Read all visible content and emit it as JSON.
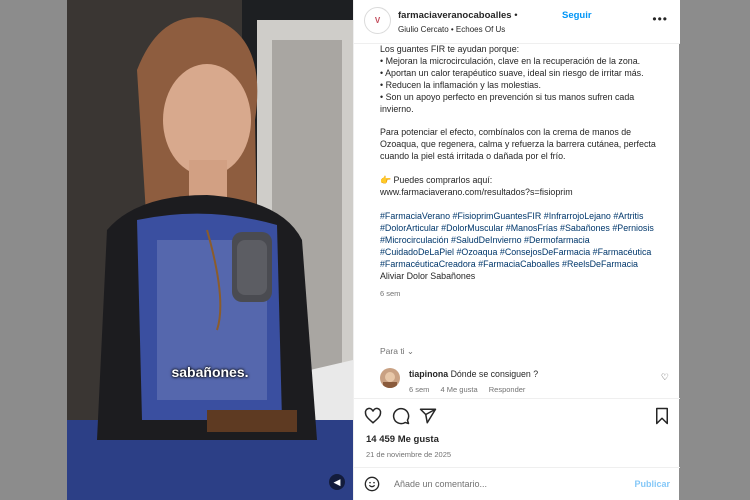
{
  "media": {
    "overlay_text": "sabañones."
  },
  "header": {
    "avatar_text": "V",
    "username": "farmaciaveranocaboalles",
    "separator": "•",
    "follow": "Seguir",
    "audio": "Giulio Cercato • Echoes Of Us"
  },
  "caption": {
    "lines": [
      "Los guantes FIR te ayudan porque:",
      "• Mejoran la microcirculación, clave en la recuperación de la zona.",
      "• Aportan un calor terapéutico suave, ideal sin riesgo de irritar más.",
      "• Reducen la inflamación y las molestias.",
      "• Son un apoyo perfecto en prevención si tus manos sufren cada invierno."
    ],
    "paragraph2": "Para potenciar el efecto, combínalos con la crema de manos de Ozoaqua, que regenera, calma y refuerza la barrera cutánea, perfecta cuando la piel está irritada o dañada por el frío.",
    "buy_label": "👉 Puedes comprarlos aquí:",
    "buy_url": "www.farmaciaverano.com/resultados?s=fisioprim",
    "hashtags": "#FarmaciaVerano #FisioprimGuantesFIR #InfrarrojoLejano #Artritis #DolorArticular #DolorMuscular #ManosFrías #Sabañones #Perniosis #Microcirculación #SaludDeInvierno #Dermofarmacia #CuidadoDeLaPiel #Ozoaqua #ConsejosDeFarmacia #Farmacéutica #FarmacéuticaCreadora #FarmaciaCaboalles #ReelsDeFarmacia",
    "audio_title": "Aliviar Dolor Sabañones",
    "time": "6 sem"
  },
  "for_you": "Para ti ⌄",
  "comment": {
    "user": "tiapinona",
    "text": "Dónde se consiguen ?",
    "time": "6 sem",
    "likes": "4 Me gusta",
    "reply": "Responder"
  },
  "likes": "14 459 Me gusta",
  "date": "21 de noviembre de 2025",
  "comment_box": {
    "placeholder": "Añade un comentario...",
    "publish": "Publicar"
  }
}
